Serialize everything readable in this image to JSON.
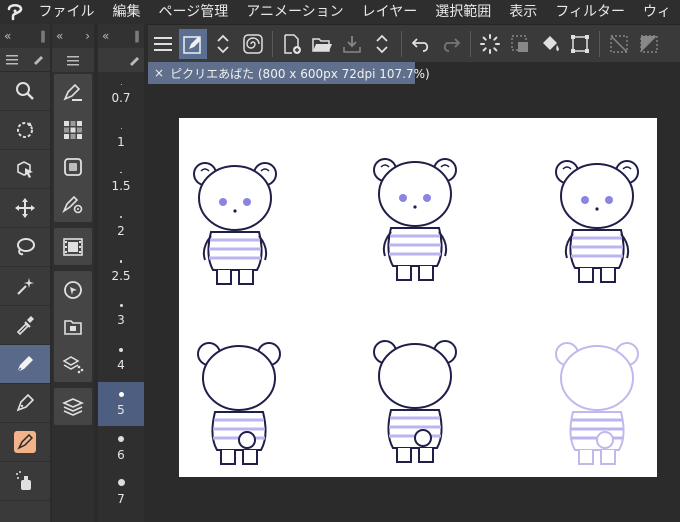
{
  "menubar": {
    "items": [
      "ファイル",
      "編集",
      "ページ管理",
      "アニメーション",
      "レイヤー",
      "選択範囲",
      "表示",
      "フィルター",
      "ウィ"
    ]
  },
  "document": {
    "tab_title": "ピクリエあばた (800 x 600px 72dpi 107.7%)",
    "close_glyph": "×"
  },
  "tools": [
    {
      "name": "zoom-tool",
      "icon": "magnifier-icon"
    },
    {
      "name": "move-tool",
      "icon": "rotate-view-icon"
    },
    {
      "name": "operation-tool",
      "icon": "object-select-icon"
    },
    {
      "name": "layer-move-tool",
      "icon": "move-arrows-icon"
    },
    {
      "name": "selection-tool",
      "icon": "lasso-icon"
    },
    {
      "name": "auto-select-tool",
      "icon": "magic-wand-icon"
    },
    {
      "name": "eyedropper-tool",
      "icon": "eyedropper-icon"
    },
    {
      "name": "pen-tool",
      "icon": "pen-icon",
      "active": true
    },
    {
      "name": "pencil-tool",
      "icon": "pencil-icon"
    },
    {
      "name": "brush-tool",
      "icon": "brush-icon"
    },
    {
      "name": "airbrush-tool",
      "icon": "airbrush-icon"
    }
  ],
  "brush_sizes": [
    "0.7",
    "1",
    "1.5",
    "2",
    "2.5",
    "3",
    "4",
    "5",
    "6",
    "7"
  ],
  "selected_size": "5",
  "colors": {
    "accent": "#5b6f92",
    "panel": "#3a3a3a",
    "line": "#1f1f4a",
    "stripe": "#b9b5f0",
    "eye": "#8b85e0",
    "faint": "#c2b8ee"
  }
}
